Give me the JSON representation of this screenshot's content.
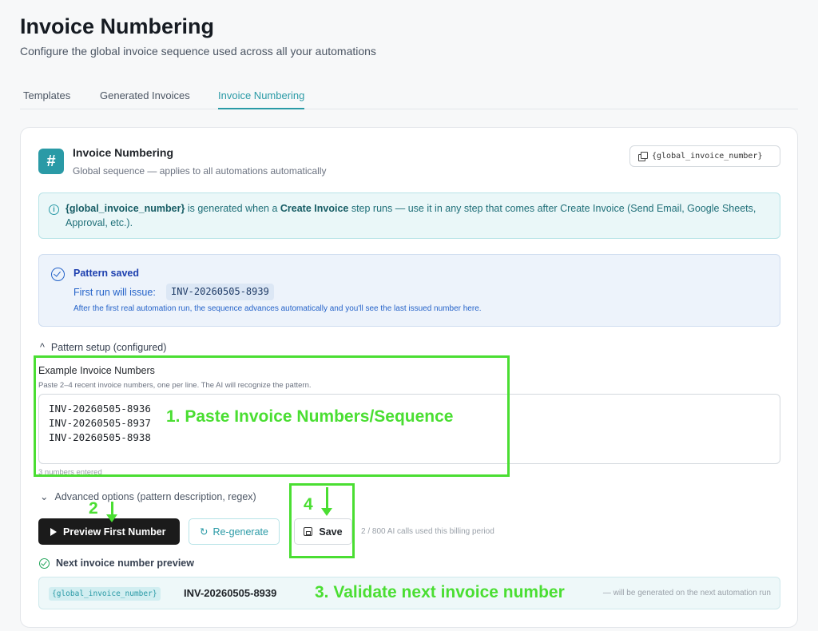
{
  "header": {
    "title": "Invoice Numbering",
    "subtitle": "Configure the global invoice sequence used across all your automations"
  },
  "tabs": [
    {
      "label": "Templates",
      "active": false
    },
    {
      "label": "Generated Invoices",
      "active": false
    },
    {
      "label": "Invoice Numbering",
      "active": true
    }
  ],
  "card": {
    "icon": "hash-icon",
    "icon_glyph": "#",
    "title": "Invoice Numbering",
    "subtitle": "Global sequence — applies to all automations automatically",
    "copy_variable": "{global_invoice_number}"
  },
  "info": {
    "icon": "info-icon",
    "icon_glyph": "i",
    "var": "{global_invoice_number}",
    "text1": " is generated when a ",
    "step": "Create Invoice",
    "text2": " step runs — use it in any step that comes after Create Invoice (Send Email, Google Sheets, Approval, etc.)."
  },
  "saved": {
    "title": "Pattern saved",
    "first_run_label": "First run will issue:",
    "first_run_value": "INV-20260505-8939",
    "note": "After the first real automation run, the sequence advances automatically and you'll see the last issued number here."
  },
  "pattern_setup": {
    "toggle_icon": "^",
    "toggle_label": "Pattern setup (configured)",
    "example_label": "Example Invoice Numbers",
    "example_help": "Paste 2–4 recent invoice numbers, one per line. The AI will recognize the pattern.",
    "examples": "INV-20260505-8936\nINV-20260505-8937\nINV-20260505-8938",
    "count_text": "3 numbers entered"
  },
  "advanced": {
    "toggle_icon": "⌄",
    "label": "Advanced options (pattern description, regex)"
  },
  "actions": {
    "preview_label": "Preview First Number",
    "regenerate_icon": "↻",
    "regenerate_label": "Re-generate",
    "save_label": "Save",
    "ai_usage": "2 / 800 AI calls used this billing period"
  },
  "next_preview": {
    "label": "Next invoice number preview",
    "var_chip": "{global_invoice_number}",
    "value": "INV-20260505-8939",
    "note": "— will be generated on the next automation run"
  },
  "annotations": {
    "step1": "1. Paste Invoice Numbers/Sequence",
    "step2": "2",
    "step3": "3. Validate next invoice number",
    "step4": "4",
    "color": "#4ade32"
  },
  "colors": {
    "accent": "#2a9aa6",
    "primary_button": "#1b1b1b",
    "saved_blue": "#2563c9"
  }
}
